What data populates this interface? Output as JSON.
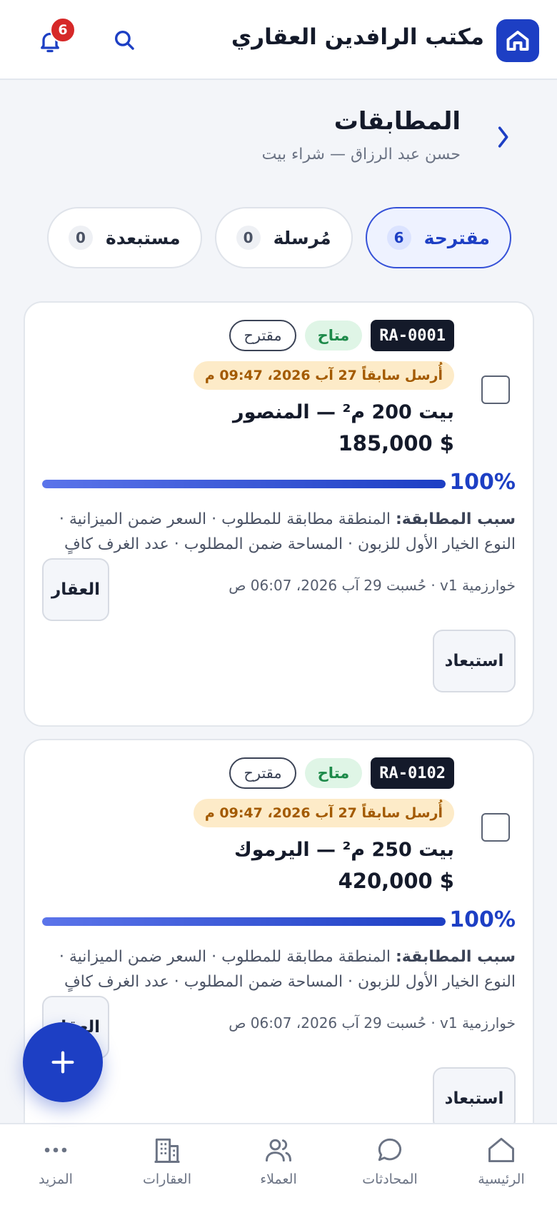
{
  "header": {
    "brand_title": "مكتب الرافدين العقاري",
    "notifications_count": "6"
  },
  "page": {
    "title": "المطابقات",
    "subtitle": "حسن عبد الرزاق — شراء بيت"
  },
  "tabs": [
    {
      "label": "مقترحة",
      "count": "6",
      "active": true
    },
    {
      "label": "مُرسلة",
      "count": "0",
      "active": false
    },
    {
      "label": "مستبعدة",
      "count": "0",
      "active": false
    }
  ],
  "cards": [
    {
      "code": "RA-0001",
      "status": "متاح",
      "stage": "مقترح",
      "sent_note": "أُرسل سابقاً 27 آب 2026، 09:47 م",
      "title": "بيت 200 م² — المنصور",
      "price": "185,000 $",
      "score_label": "100%",
      "score": 100,
      "reason_label": "سبب المطابقة:",
      "reason_text": "المنطقة مطابقة للمطلوب · السعر ضمن الميزانية · النوع الخيار الأول للزبون · المساحة ضمن المطلوب · عدد الغرف كافٍ",
      "algo": "خوارزمية v1 · حُسبت 29 آب 2026، 06:07 ص",
      "property_button": "العقار",
      "exclude_button": "استبعاد"
    },
    {
      "code": "RA-0102",
      "status": "متاح",
      "stage": "مقترح",
      "sent_note": "أُرسل سابقاً 27 آب 2026، 09:47 م",
      "title": "بيت 250 م² — اليرموك",
      "price": "420,000 $",
      "score_label": "100%",
      "score": 100,
      "reason_label": "سبب المطابقة:",
      "reason_text": "المنطقة مطابقة للمطلوب · السعر ضمن الميزانية · النوع الخيار الأول للزبون · المساحة ضمن المطلوب · عدد الغرف كافٍ",
      "algo": "خوارزمية v1 · حُسبت 29 آب 2026، 06:07 ص",
      "property_button": "العقار",
      "exclude_button": "استبعاد"
    }
  ],
  "bottom_nav": [
    {
      "label": "الرئيسية",
      "icon": "home-icon"
    },
    {
      "label": "المحادثات",
      "icon": "chat-icon"
    },
    {
      "label": "العملاء",
      "icon": "users-icon"
    },
    {
      "label": "العقارات",
      "icon": "building-icon"
    },
    {
      "label": "المزيد",
      "icon": "more-icon"
    }
  ],
  "colors": {
    "primary": "#1d3fc4",
    "available": "#1e8a4a",
    "sent_badge": "#a35a00",
    "notification_badge": "#d62828"
  }
}
